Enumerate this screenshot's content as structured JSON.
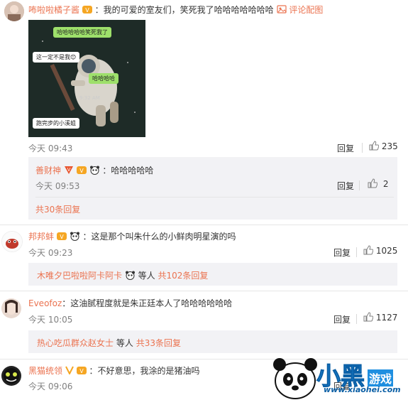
{
  "comments": [
    {
      "user": "咘啦啦橘子酱",
      "text": "：我的可爱的室友们，笑死我了哈哈哈哈哈哈哈",
      "reply_image_label": "评论配图",
      "time": "今天 09:43",
      "reply": "回复",
      "likes": "235",
      "image": {
        "b1": "哈哈哈哈哈笑死我了",
        "b2": "这一定不是我😊",
        "b3": "哈哈哈哈",
        "clock": "9:32 AM",
        "b4": "跑完步的小溪姐"
      },
      "sub": {
        "user": "善财神",
        "text": "：哈哈哈哈哈",
        "time": "今天 09:53",
        "reply": "回复",
        "likes": "2",
        "total": "共30条回复"
      }
    },
    {
      "user": "邦邦蚌",
      "text": "：这是那个叫朱什么的小鲜肉明星演的吗",
      "time": "今天 09:23",
      "reply": "回复",
      "likes": "1025",
      "sub_users": "木唯夕巴啦啦阿卡阿卡",
      "sub_suffix": "等人",
      "total": "共102条回复"
    },
    {
      "user": "Eveofoz",
      "text": "：这油腻程度就是朱正廷本人了哈哈哈哈哈哈",
      "time": "今天 10:05",
      "reply": "回复",
      "likes": "1127",
      "sub_users": "热心吃瓜群众赵女士",
      "sub_suffix": "等人",
      "total": "共33条回复"
    },
    {
      "user": "黑猫统领",
      "text": "：不好意思，我涂的是猪油吗",
      "time": "今天 09:06",
      "reply": "回复"
    }
  ],
  "watermark": {
    "big": "小黑",
    "small": "游戏",
    "url": "www.xiaohei.com"
  },
  "colors": {
    "username": "#eb7350",
    "text": "#333333",
    "meta": "#808080",
    "subbox": "#f2f2f5"
  }
}
